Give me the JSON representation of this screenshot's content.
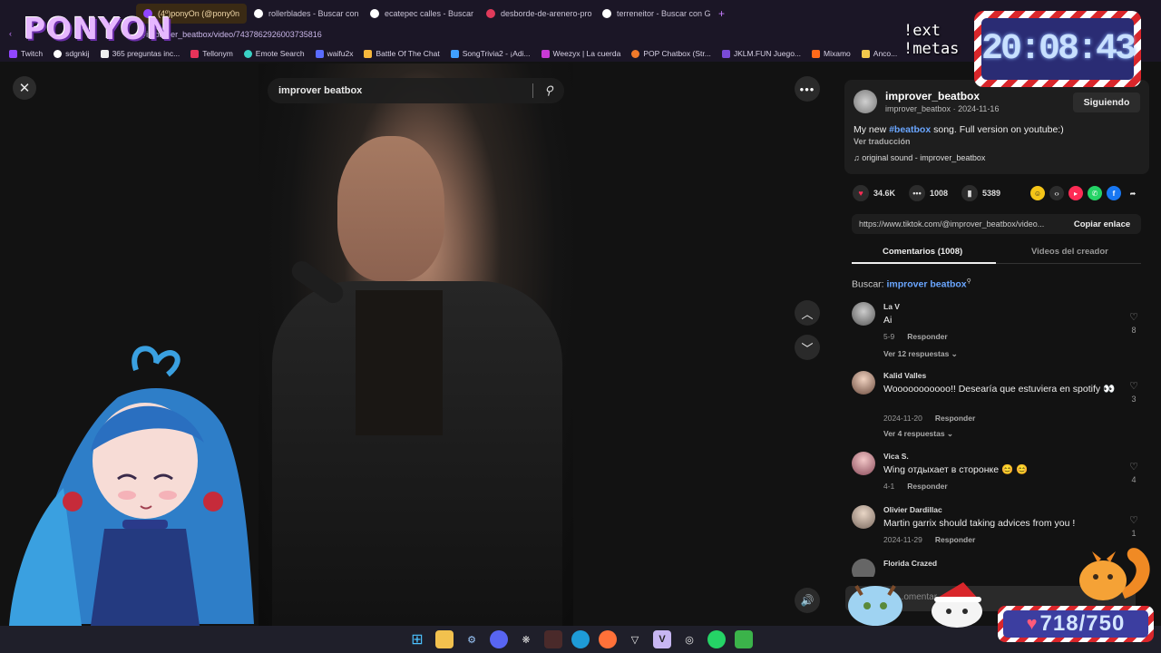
{
  "browser": {
    "tabs": [
      {
        "label": "(4º)ponyOn (@pony0n",
        "active": true
      },
      {
        "label": "rollerblades - Buscar con",
        "active": false
      },
      {
        "label": "ecatepec calles - Buscar",
        "active": false
      },
      {
        "label": "desborde-de-arenero-pro",
        "active": false
      },
      {
        "label": "terreneitor - Buscar con G",
        "active": false
      }
    ],
    "new_tab": "+",
    "url": "@improver_beatbox/video/7437862926003735816",
    "bookmarks": [
      "Twitch",
      "sdgnkij",
      "365 preguntas inc...",
      "Tellonym",
      "Emote Search",
      "waifu2x",
      "Battle Of The Chat",
      "SongTrivia2 - ¡Adi...",
      "Weezyx | La cuerda",
      "POP Chatbox (Str...",
      "JKLM.FUN Juego...",
      "Mixamo",
      "Anco..."
    ]
  },
  "video": {
    "search_text": "improver beatbox"
  },
  "post": {
    "author": "improver_beatbox",
    "author_handle": "improver_beatbox",
    "date": "2024-11-16",
    "meta_separator": "·",
    "follow_label": "Siguiendo",
    "caption_before": "My new ",
    "caption_tag": "#beatbox",
    "caption_after": " song. Full version on youtube:)",
    "translate_label": "Ver traducción",
    "sound": "original sound - improver_beatbox",
    "likes": "34.6K",
    "comments_count": "1008",
    "saves": "5389",
    "link": "https://www.tiktok.com/@improver_beatbox/video...",
    "copy_link_label": "Copiar enlace",
    "tab_comments": "Comentarios (1008)",
    "tab_creator": "Videos del creador",
    "search_prefix": "Buscar: ",
    "search_term": "improver beatbox",
    "comment_placeholder": "...omentar..."
  },
  "comments": [
    {
      "name": "La V",
      "text": "Ai",
      "date": "5-9",
      "reply_label": "Responder",
      "likes": "8",
      "replies": "Ver 12 respuestas ⌄"
    },
    {
      "name": "Kalid Valles",
      "text": "Wooooooooooo!! Desearía que estuviera en spotify 👀",
      "date": "2024-11-20",
      "reply_label": "Responder",
      "likes": "3",
      "replies": "Ver 4 respuestas ⌄"
    },
    {
      "name": "Vica S.",
      "text": "Wing отдыхает в сторонке 😊 😊",
      "date": "4-1",
      "reply_label": "Responder",
      "likes": "4",
      "replies": ""
    },
    {
      "name": "Olivier Dardillac",
      "text": "Martin garrix should taking advices from you !",
      "date": "2024-11-29",
      "reply_label": "Responder",
      "likes": "1",
      "replies": ""
    },
    {
      "name": "Florida Crazed",
      "text": "",
      "date": "",
      "reply_label": "",
      "likes": "",
      "replies": ""
    }
  ],
  "overlay": {
    "logo": "PONYON",
    "command_line1": "!ext",
    "command_line2": "!metas",
    "clock": "20:08:43",
    "goal_heart": "♥",
    "goal": "718/750"
  },
  "colors": {
    "accent_link": "#6aa6ff",
    "like_heart": "#fe2c55",
    "clock_bg": "#2a2c74",
    "candy_red": "#d9262b"
  }
}
